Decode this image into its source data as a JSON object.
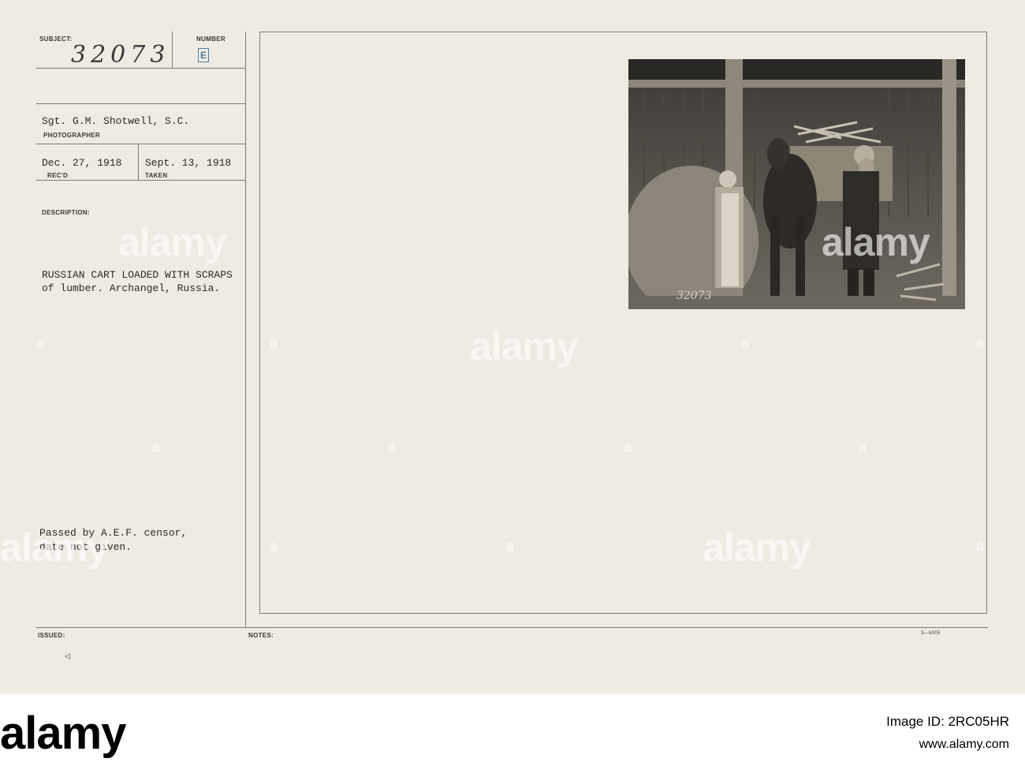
{
  "card": {
    "subject_label": "SUBJECT:",
    "subject_number": "32073",
    "number_label": "NUMBER",
    "number_stamp": "E",
    "photographer_name": "Sgt. G.M. Shotwell, S.C.",
    "photographer_label": "PHOTOGRAPHER",
    "received_date": "Dec. 27, 1918",
    "received_label": "REC'D",
    "taken_date": "Sept. 13, 1918",
    "taken_label": "TAKEN",
    "description_label": "DESCRIPTION:",
    "description_line1": "RUSSIAN CART LOADED WITH SCRAPS",
    "description_line2": "of lumber. Archangel, Russia.",
    "censor_line1": "Passed by A.E.F. censor,",
    "censor_line2": "date not given.",
    "issued_label": "ISSUED:",
    "issued_mark": "◁",
    "notes_label": "NOTES:",
    "form_code": "3—5005",
    "photo_number": "32073"
  },
  "watermark": {
    "text": "alamy",
    "small_text": "a"
  },
  "footer": {
    "logo": "alamy",
    "image_id_label": "Image ID: 2RC05HR",
    "site": "www.alamy.com"
  },
  "colors": {
    "card_background": "#efebe3",
    "rule_lines": "#7f7a72",
    "stamp_blue": "#4a7fa0"
  },
  "icons": {
    "issued_mark": "triangle-left-icon"
  }
}
